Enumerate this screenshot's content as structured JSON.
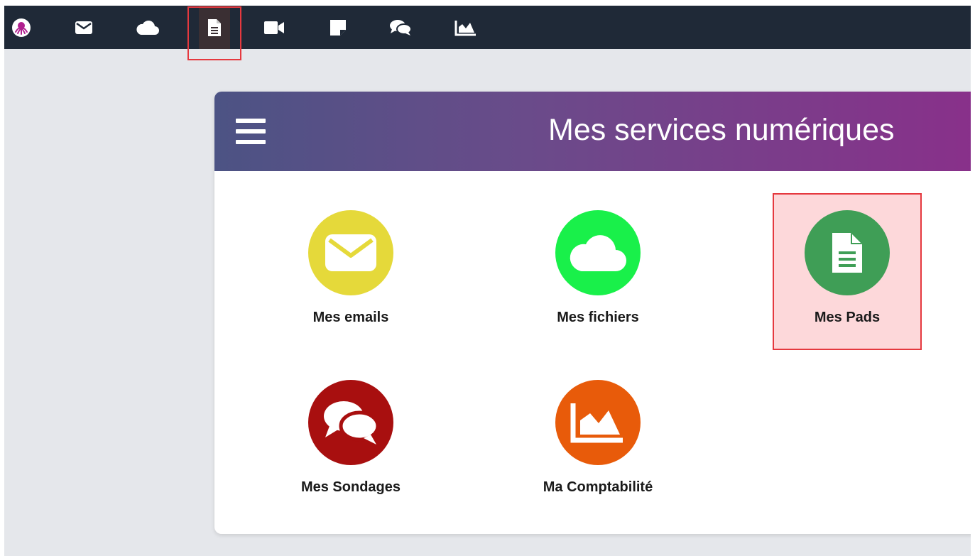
{
  "topbar": {
    "items": [
      {
        "name": "app-logo",
        "icon": "octopus-logo-icon"
      },
      {
        "name": "mail",
        "icon": "envelope-icon"
      },
      {
        "name": "files",
        "icon": "cloud-icon"
      },
      {
        "name": "pads",
        "icon": "document-icon",
        "active": true
      },
      {
        "name": "video",
        "icon": "video-camera-icon"
      },
      {
        "name": "notes",
        "icon": "sticky-note-icon"
      },
      {
        "name": "polls",
        "icon": "chat-bubbles-icon"
      },
      {
        "name": "accounting",
        "icon": "area-chart-icon"
      }
    ]
  },
  "card": {
    "title": "Mes services numériques",
    "menu_icon": "hamburger-menu-icon"
  },
  "services": [
    {
      "label": "Mes emails",
      "icon": "envelope-icon",
      "color": "#e5d93a"
    },
    {
      "label": "Mes fichiers",
      "icon": "cloud-icon",
      "color": "#19f04a"
    },
    {
      "label": "Mes Pads",
      "icon": "document-icon",
      "color": "#3f9e56",
      "highlighted": true
    },
    {
      "label": "Mes Sondages",
      "icon": "chat-bubbles-icon",
      "color": "#a80f0f"
    },
    {
      "label": "Ma Comptabilité",
      "icon": "area-chart-icon",
      "color": "#e85b0a"
    }
  ],
  "colors": {
    "topbar_bg": "#1f2937",
    "page_bg": "#e5e7eb",
    "highlight_border": "#e5393f",
    "highlight_fill": "#fdd8da",
    "header_gradient_start": "#4c5384",
    "header_gradient_end": "#8a2f8a"
  }
}
